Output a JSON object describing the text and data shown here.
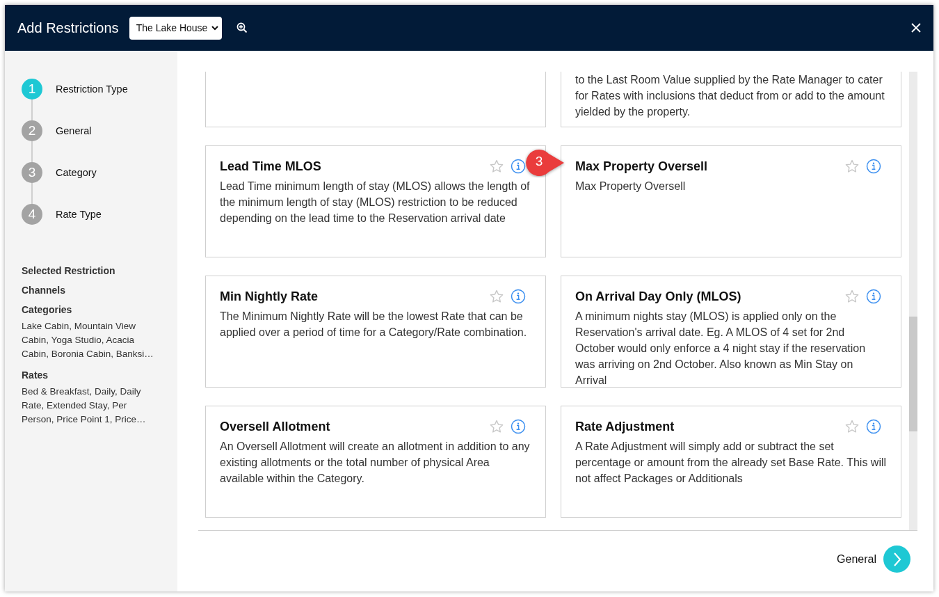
{
  "dialog": {
    "title": "Add Restrictions",
    "property_select": {
      "value": "The Lake House"
    }
  },
  "steps": [
    {
      "number": "1",
      "label": "Restriction Type",
      "selected": true
    },
    {
      "number": "2",
      "label": "General",
      "selected": false
    },
    {
      "number": "3",
      "label": "Category",
      "selected": false
    },
    {
      "number": "4",
      "label": "Rate Type",
      "selected": false
    }
  ],
  "summary": [
    {
      "heading": "Selected Restriction"
    },
    {
      "heading": "Channels"
    },
    {
      "heading": "Categories",
      "value": "Lake Cabin, Mountain View Cabin, Yoga Studio, Acacia Cabin, Boronia Cabin, Banksi…"
    },
    {
      "heading": "Rates",
      "value": "Bed & Breakfast, Daily, Daily Rate, Extended Stay, Per Person, Price Point 1, Price…"
    }
  ],
  "cards": [
    {
      "kind": "partial"
    },
    {
      "kind": "partial",
      "description": "to the Last Room Value supplied by the Rate Manager to cater for Rates with inclusions that deduct from or add to the amount yielded by the property."
    },
    {
      "kind": "full",
      "title": "Lead Time MLOS",
      "description": "Lead Time minimum length of stay (MLOS) allows the length of the minimum length of stay (MLOS) restriction to be reduced depending on the lead time to the Reservation arrival date",
      "favorite": false
    },
    {
      "kind": "full",
      "title": "Max Property Oversell",
      "description": "Max Property Oversell",
      "favorite": false
    },
    {
      "kind": "full",
      "title": "Min Nightly Rate",
      "description": "The Minimum Nightly Rate will be the lowest Rate that can be applied over a period of time for a Category/Rate combination.",
      "favorite": false
    },
    {
      "kind": "full",
      "title": "On Arrival Day Only (MLOS)",
      "description": "A minimum nights stay (MLOS) is applied only on the Reservation's arrival date. Eg. A MLOS of 4 set for 2nd October would only enforce a 4 night stay if the reservation was arriving on 2nd October. Also known as Min Stay on Arrival",
      "favorite": false
    },
    {
      "kind": "full",
      "title": "Oversell Allotment",
      "description": "An Oversell Allotment will create an allotment in addition to any existing allotments or the total number of physical Area available within the Category.",
      "favorite": false
    },
    {
      "kind": "full",
      "title": "Rate Adjustment",
      "description": "A Rate Adjustment will simply add or subtract the set percentage or amount from the already set Base Rate. This will not affect Packages or Additionals",
      "favorite": false
    }
  ],
  "annotation": {
    "number": "3"
  },
  "next_button": {
    "label": "General"
  }
}
